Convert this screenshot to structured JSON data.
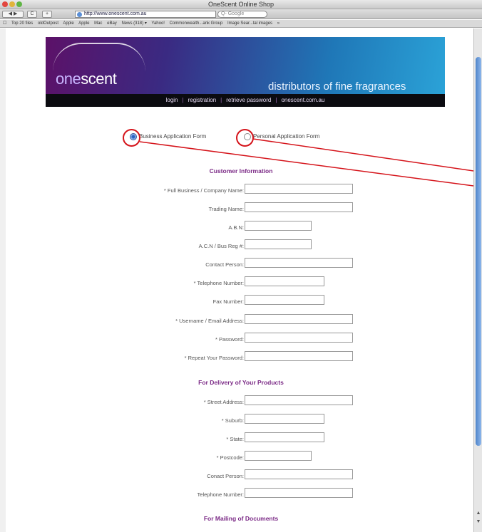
{
  "window": {
    "title": "OneScent Online Shop"
  },
  "toolbar": {
    "back_label": "◀ ▶",
    "reload_label": "C",
    "add_label": "+",
    "url_value": "http://www.onescent.com.au",
    "search_placeholder": "Q- Google"
  },
  "bookmarks": [
    "Top 20 files",
    "oldOutpost",
    "Apple",
    "Apple",
    "Mac",
    "eBay",
    "News (318) ▾",
    "Yahoo!",
    "Commonwealth...ank Group",
    "Image Sear...tal images",
    "»"
  ],
  "header": {
    "logo_prefix": "one",
    "logo_suffix": "scent",
    "tagline": "distributors of fine fragrances"
  },
  "nav": {
    "items": [
      "login",
      "registration",
      "retrieve password",
      "onescent.com.au"
    ],
    "separator": "|"
  },
  "form_type": {
    "business_label": "Business Application Form",
    "personal_label": "Personal Application Form",
    "selected": "business"
  },
  "sections": {
    "customer_info": "Customer Information",
    "delivery": "For Delivery of Your Products",
    "mailing": "For Mailing of Documents"
  },
  "fields": {
    "company_name": "* Full Business / Company Name:",
    "trading_name": "Trading Name:",
    "abn": "A.B.N:",
    "acn": "A.C.N / Bus Reg #:",
    "contact_person": "Contact Person:",
    "telephone": "* Telephone Number:",
    "fax": "Fax Number:",
    "username_email": "* Username / Email Address:",
    "password": "* Password:",
    "repeat_password": "* Repeat Your Password:",
    "street_address": "* Street Address:",
    "suburb": "* Suburb:",
    "state": "* State:",
    "postcode": "* Postcode:",
    "delivery_contact": "Conact Person:",
    "delivery_telephone": "Telephone Number:"
  },
  "colors": {
    "section_title": "#7b2a86",
    "annotation": "#d5141b",
    "nav_bg": "#0b0b10"
  }
}
